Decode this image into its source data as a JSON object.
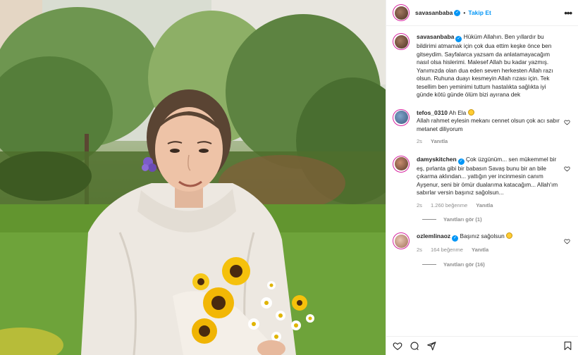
{
  "post": {
    "username": "savasanbaba",
    "verified": true,
    "follow_label": "Takip Et",
    "caption": "Hüküm Allahın. Ben yıllardır bu bildirimi atmamak için çok dua ettim keşke önce ben gitseydim. Sayfalarca yazsam da anlatamayacağım nasıl olsa hislerimi. Malesef Allah bu kadar yazmış. Yanımızda olan dua eden seven herkesten Allah razı olsun. Ruhuna duayı kesmeyin Allah rızası için. Tek tesellim ben yeminimi tuttum hastalıkta sağlıkta iyi günde kötü günde ölüm bizi ayırana dek"
  },
  "comments": [
    {
      "username": "tefos_0310",
      "verified": false,
      "lead": "Ah Ela",
      "text": "Allah rahmet eylesin mekanı cennet olsun çok acı sabır metanet diliyorum",
      "time": "2s",
      "likes": "",
      "reply_label": "Yanıtla"
    },
    {
      "username": "damyskitchen",
      "verified": true,
      "lead": "Çok üzgünüm... sen mükemmel bir eş, pırlanta gibi bir babasın Savaş bunu bir an bile çıkarma aklından... yattığın yer incinmesin canım Ayşenur, seni bir ömür dualarıma katacağım... Allah'ım sabırlar versin başınız sağolsun...",
      "text": "",
      "time": "2s",
      "likes": "1.260 beğenme",
      "reply_label": "Yanıtla",
      "view_replies": "Yanıtları gör (1)"
    },
    {
      "username": "ozlemlinaoz",
      "verified": true,
      "lead": "Başınız sağolsun",
      "text": "",
      "time": "2s",
      "likes": "164 beğenme",
      "reply_label": "Yanıtla",
      "view_replies": "Yanıtları gör (16)"
    }
  ],
  "colors": {
    "link_blue": "#0095f6",
    "muted": "#8e8e8e",
    "text": "#262626"
  },
  "icons": [
    "more-icon",
    "verified-icon",
    "heart-icon",
    "comment-icon",
    "share-icon",
    "save-icon",
    "smile-emoji-icon"
  ]
}
